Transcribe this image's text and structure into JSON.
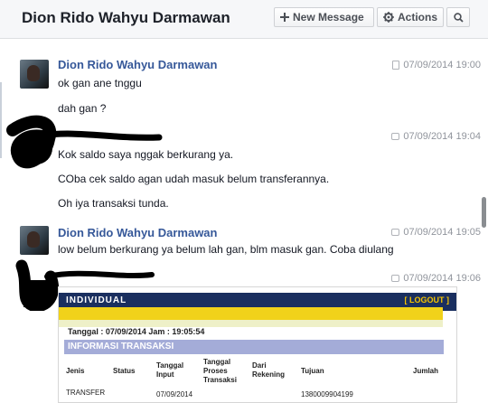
{
  "header": {
    "title": "Dion Rido Wahyu Darmawan",
    "new_message_label": "New Message",
    "actions_label": "Actions"
  },
  "messages": [
    {
      "name": "Dion Rido Wahyu Darmawan",
      "time": "07/09/2014 19:00",
      "lines": [
        "ok gan ane tnggu",
        "dah gan ?"
      ]
    },
    {
      "name": "",
      "time": "07/09/2014 19:04",
      "lines": [
        "Kok saldo saya nggak berkurang ya.",
        "COba cek saldo agan udah masuk belum transferannya.",
        "Oh iya transaksi tunda."
      ]
    },
    {
      "name": "Dion Rido Wahyu Darmawan",
      "time": "07/09/2014 19:05",
      "lines": [
        "low belum berkurang ya belum lah gan, blm masuk gan. Coba diulang"
      ]
    },
    {
      "name": "",
      "time": "07/09/2014 19:06",
      "lines": []
    }
  ],
  "attachment": {
    "header_label": "INDIVIDUAL",
    "logout": "[ LOGOUT ]",
    "date_line": "Tanggal : 07/09/2014 Jam : 19:05:54",
    "section_title": "INFORMASI TRANSAKSI",
    "columns": [
      "Jenis",
      "Status",
      "Tanggal Input",
      "Tanggal Proses Transaksi",
      "Dari Rekening",
      "Tujuan",
      "Jumlah"
    ],
    "row": [
      "TRANSFER",
      "07/09/2014",
      "1380009904199"
    ]
  },
  "colors": {
    "name_link": "#365899",
    "header_bg": "#f6f7f9",
    "bank_navy": "#1a2f5f",
    "bank_yellow": "#f1d21a"
  }
}
